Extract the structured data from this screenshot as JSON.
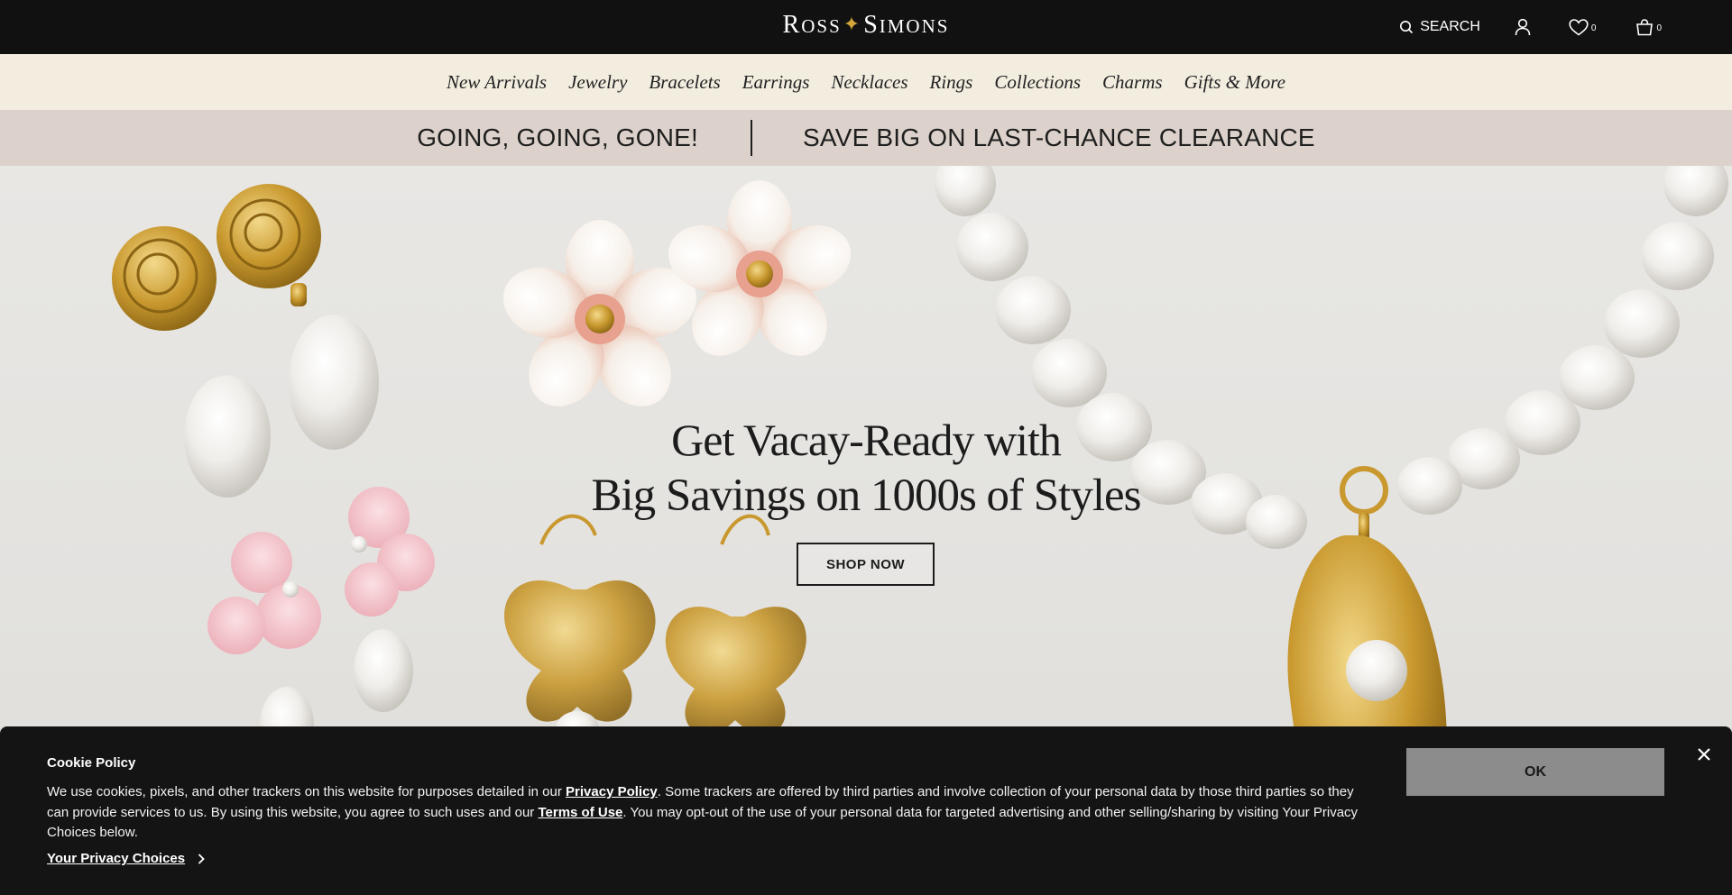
{
  "header": {
    "logo": {
      "part1_cap": "R",
      "part1_rest": "OSS",
      "star": "✦",
      "part2_cap": "S",
      "part2_rest": "IMONS"
    },
    "search_label": "SEARCH",
    "wishlist_count": "0",
    "cart_count": "0"
  },
  "nav": {
    "items": [
      {
        "label": "New Arrivals"
      },
      {
        "label": "Jewelry"
      },
      {
        "label": "Bracelets"
      },
      {
        "label": "Earrings"
      },
      {
        "label": "Necklaces"
      },
      {
        "label": "Rings"
      },
      {
        "label": "Collections"
      },
      {
        "label": "Charms"
      },
      {
        "label": "Gifts & More"
      }
    ]
  },
  "promo": {
    "left": "GOING, GOING, GONE!",
    "right": "SAVE BIG ON LAST-CHANCE CLEARANCE"
  },
  "hero": {
    "line1": "Get Vacay-Ready with",
    "line2": "Big Savings on 1000s of Styles",
    "cta": "SHOP NOW"
  },
  "cookie": {
    "title": "Cookie Policy",
    "text_1": "We use cookies, pixels, and other trackers on this website for purposes detailed in our ",
    "privacy_policy_link": "Privacy Policy",
    "text_2": ". Some trackers are offered by third parties and involve collection of your personal data by those third parties so they can provide services to us. By using this website, you agree to such uses and our ",
    "terms_link": "Terms of Use",
    "text_3": ". You may opt-out of the use of your personal data for targeted advertising and other selling/sharing by visiting Your Privacy Choices below.",
    "privacy_choices": "Your Privacy Choices",
    "ok_label": "OK"
  },
  "colors": {
    "topbar": "#111111",
    "nav_bg": "#f3ede0",
    "promo_bg": "#dcd2cb",
    "gold": "#d4a63a",
    "cookie_bg": "#141414",
    "ok_bg": "#8c8c8c"
  },
  "icons": [
    "search-icon",
    "account-icon",
    "heart-icon",
    "cart-icon",
    "close-icon",
    "chevron-right-icon"
  ]
}
